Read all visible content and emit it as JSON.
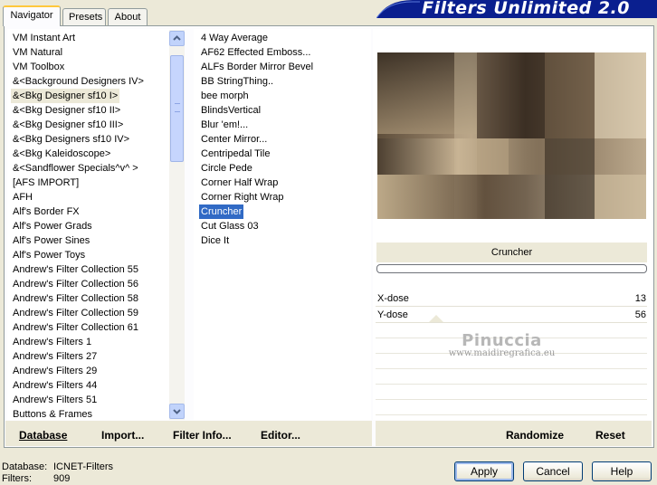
{
  "tabs": [
    {
      "label": "Navigator",
      "active": true
    },
    {
      "label": "Presets",
      "active": false
    },
    {
      "label": "About",
      "active": false
    }
  ],
  "app_title": "Filters Unlimited 2.0",
  "categories": [
    "VM Instant Art",
    "VM Natural",
    "VM Toolbox",
    "&<Background Designers IV>",
    "&<Bkg Designer sf10 I>",
    "&<Bkg Designer sf10 II>",
    "&<Bkg Designer sf10 III>",
    "&<Bkg Designers sf10 IV>",
    "&<Bkg Kaleidoscope>",
    "&<Sandflower Specials^v^ >",
    "[AFS IMPORT]",
    "AFH",
    "Alf's Border FX",
    "Alf's Power Grads",
    "Alf's Power Sines",
    "Alf's Power Toys",
    "Andrew's Filter Collection 55",
    "Andrew's Filter Collection 56",
    "Andrew's Filter Collection 58",
    "Andrew's Filter Collection 59",
    "Andrew's Filter Collection 61",
    "Andrew's Filters 1",
    "Andrew's Filters 27",
    "Andrew's Filters 29",
    "Andrew's Filters 44",
    "Andrew's Filters 51",
    "Buttons & Frames"
  ],
  "selected_category": "&<Bkg Designer sf10 I>",
  "filters": [
    "4 Way Average",
    "AF62 Effected Emboss...",
    "ALFs Border Mirror Bevel",
    "BB StringThing..",
    "bee morph",
    "BlindsVertical",
    "Blur 'em!...",
    "Center Mirror...",
    "Centripedal Tile",
    "Circle Pede",
    "Corner Half Wrap",
    "Corner Right Wrap",
    "Cruncher",
    "Cut Glass  03",
    "Dice It"
  ],
  "selected_filter": "Cruncher",
  "preview": {
    "filter_name": "Cruncher",
    "progress": 0
  },
  "params": [
    {
      "label": "X-dose",
      "value": "13"
    },
    {
      "label": "Y-dose",
      "value": "56"
    }
  ],
  "watermark": {
    "line1": "Pinuccia",
    "line2": "www.maidiregrafica.eu"
  },
  "left_buttons": {
    "database": "Database",
    "import": "Import...",
    "filter_info": "Filter Info...",
    "editor": "Editor..."
  },
  "right_buttons": {
    "randomize": "Randomize",
    "reset": "Reset"
  },
  "status": {
    "database_label": "Database:",
    "database_value": "ICNET-Filters",
    "filters_label": "Filters:",
    "filters_value": "909"
  },
  "dialog_buttons": {
    "apply": "Apply",
    "cancel": "Cancel",
    "help": "Help"
  },
  "colors": {
    "selection_blue": "#316ac5",
    "banner_navy": "#0a1f8f",
    "dialog_bg": "#ece9d8"
  }
}
